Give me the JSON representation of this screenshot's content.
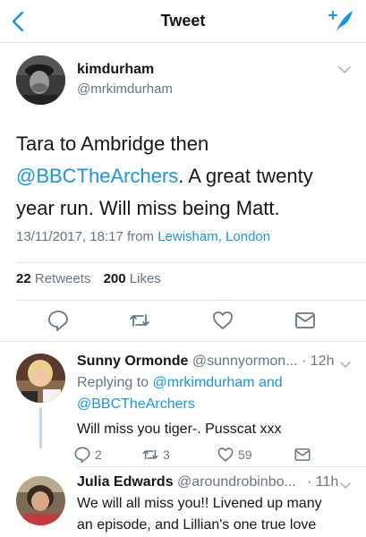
{
  "navbar": {
    "title": "Tweet",
    "back_icon": "chevron-left-icon",
    "compose_icon": "compose-tweet-icon"
  },
  "tweet": {
    "author_name": "kimdurham",
    "author_handle": "@mrkimdurham",
    "text_line1": "Tara to Ambridge then",
    "mention": "@BBCTheArchers",
    "text_after_mention": ". A great twenty",
    "text_line3": "year run. Will miss being Matt.",
    "timestamp": "13/11/2017, 18:17",
    "from_label": "from",
    "location": "Lewisham, London",
    "retweets_count": "22",
    "retweets_label": "Retweets",
    "likes_count": "200",
    "likes_label": "Likes"
  },
  "actions": {
    "reply_icon": "reply-icon",
    "retweet_icon": "retweet-icon",
    "like_icon": "heart-icon",
    "share_icon": "share-icon"
  },
  "replies": [
    {
      "name": "Sunny Ormonde",
      "handle": "@sunnyormon...",
      "time": "· 12h",
      "replying_to_label": "Replying to",
      "replying_to_1": "@mrkimdurham",
      "replying_and": "and",
      "replying_to_2": "@BBCTheArchers",
      "text": "Will miss you tiger-. Pusscat xxx",
      "reply_count": "2",
      "retweet_count": "3",
      "like_count": "59"
    },
    {
      "name": "Julia Edwards",
      "handle": "@aroundrobinbo...",
      "time": "· 11h",
      "text_line1": "We will all miss you!! Livened up many",
      "text_line2": "an episode, and Lillian's one true love"
    }
  ],
  "colors": {
    "accent": "#1b95e0",
    "muted": "#657786",
    "text": "#14171a",
    "divider": "#e1e8ed"
  }
}
